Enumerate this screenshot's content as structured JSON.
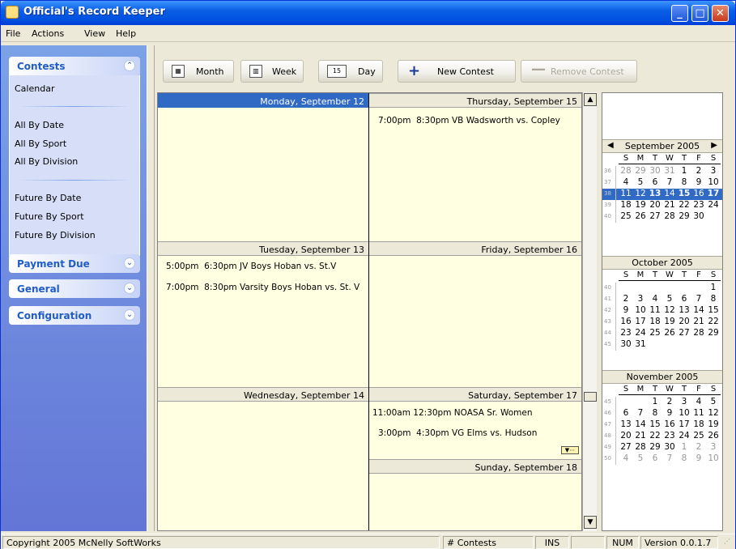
{
  "window": {
    "title": "Official's Record Keeper",
    "btn_min": "_",
    "btn_max": "□",
    "btn_close": "✕"
  },
  "menu": [
    "File",
    "Actions",
    "View",
    "Help"
  ],
  "sidebar": {
    "contests": {
      "title": "Contests",
      "items": [
        "Calendar",
        "All By Date",
        "All By Sport",
        "All By Division",
        "Future By Date",
        "Future By Sport",
        "Future By Division"
      ]
    },
    "collapsed": [
      "Payment Due",
      "General",
      "Configuration"
    ],
    "expand_glyph": "⌄",
    "collapse_glyph": "⌃"
  },
  "toolbar": {
    "month": "Month",
    "week": "Week",
    "day": "Day",
    "new_contest": "New Contest",
    "remove_contest": "Remove Contest",
    "plus": "+",
    "minus": "—"
  },
  "week_view": {
    "days": [
      {
        "label": "Monday, September 12",
        "selected": true,
        "appointments": []
      },
      {
        "label": "Tuesday, September 13",
        "selected": false,
        "appointments": [
          {
            "start": "5:00pm",
            "end": "6:30pm",
            "title": "JV Boys Hoban vs. St.V"
          },
          {
            "start": "7:00pm",
            "end": "8:30pm",
            "title": "Varsity Boys Hoban vs. St. V"
          }
        ]
      },
      {
        "label": "Wednesday, September 14",
        "selected": false,
        "appointments": []
      },
      {
        "label": "Thursday, September 15",
        "selected": false,
        "appointments": [
          {
            "start": "7:00pm",
            "end": "8:30pm",
            "title": "VB Wadsworth vs. Copley"
          }
        ]
      },
      {
        "label": "Friday, September 16",
        "selected": false,
        "appointments": []
      },
      {
        "label": "Saturday, September 17",
        "selected": false,
        "appointments": [
          {
            "start": "11:00am",
            "end": "12:30pm",
            "title": "NOASA Sr. Women"
          },
          {
            "start": "3:00pm",
            "end": "4:30pm",
            "title": "VG Elms vs. Hudson"
          }
        ]
      },
      {
        "label": "Sunday, September 18",
        "selected": false,
        "appointments": []
      }
    ]
  },
  "minicals": [
    {
      "title": "September 2005",
      "nav": true,
      "dow": [
        "S",
        "M",
        "T",
        "W",
        "T",
        "F",
        "S"
      ],
      "weeks": [
        {
          "wk": "36",
          "days": [
            "28",
            "29",
            "30",
            "31",
            "1",
            "2",
            "3"
          ],
          "other": [
            0,
            1,
            2,
            3
          ]
        },
        {
          "wk": "37",
          "days": [
            "4",
            "5",
            "6",
            "7",
            "8",
            "9",
            "10"
          ],
          "other": []
        },
        {
          "wk": "38",
          "days": [
            "11",
            "12",
            "13",
            "14",
            "15",
            "16",
            "17"
          ],
          "other": [],
          "selected": true,
          "bold": [
            2,
            4,
            6
          ]
        },
        {
          "wk": "39",
          "days": [
            "18",
            "19",
            "20",
            "21",
            "22",
            "23",
            "24"
          ],
          "other": []
        },
        {
          "wk": "40",
          "days": [
            "25",
            "26",
            "27",
            "28",
            "29",
            "30",
            ""
          ],
          "other": []
        }
      ]
    },
    {
      "title": "October 2005",
      "nav": false,
      "dow": [
        "S",
        "M",
        "T",
        "W",
        "T",
        "F",
        "S"
      ],
      "weeks": [
        {
          "wk": "40",
          "days": [
            "",
            "",
            "",
            "",
            "",
            "",
            "1"
          ],
          "other": []
        },
        {
          "wk": "41",
          "days": [
            "2",
            "3",
            "4",
            "5",
            "6",
            "7",
            "8"
          ],
          "other": []
        },
        {
          "wk": "42",
          "days": [
            "9",
            "10",
            "11",
            "12",
            "13",
            "14",
            "15"
          ],
          "other": []
        },
        {
          "wk": "43",
          "days": [
            "16",
            "17",
            "18",
            "19",
            "20",
            "21",
            "22"
          ],
          "other": []
        },
        {
          "wk": "44",
          "days": [
            "23",
            "24",
            "25",
            "26",
            "27",
            "28",
            "29"
          ],
          "other": []
        },
        {
          "wk": "45",
          "days": [
            "30",
            "31",
            "",
            "",
            "",
            "",
            ""
          ],
          "other": []
        }
      ]
    },
    {
      "title": "November 2005",
      "nav": false,
      "dow": [
        "S",
        "M",
        "T",
        "W",
        "T",
        "F",
        "S"
      ],
      "weeks": [
        {
          "wk": "45",
          "days": [
            "",
            "",
            "1",
            "2",
            "3",
            "4",
            "5"
          ],
          "other": []
        },
        {
          "wk": "46",
          "days": [
            "6",
            "7",
            "8",
            "9",
            "10",
            "11",
            "12"
          ],
          "other": []
        },
        {
          "wk": "47",
          "days": [
            "13",
            "14",
            "15",
            "16",
            "17",
            "18",
            "19"
          ],
          "other": []
        },
        {
          "wk": "48",
          "days": [
            "20",
            "21",
            "22",
            "23",
            "24",
            "25",
            "26"
          ],
          "other": []
        },
        {
          "wk": "49",
          "days": [
            "27",
            "28",
            "29",
            "30",
            "1",
            "2",
            "3"
          ],
          "other": [
            4,
            5,
            6
          ]
        },
        {
          "wk": "50",
          "days": [
            "4",
            "5",
            "6",
            "7",
            "8",
            "9",
            "10"
          ],
          "other": [
            0,
            1,
            2,
            3,
            4,
            5,
            6
          ]
        }
      ]
    }
  ],
  "status": {
    "copyright": "Copyright 2005 McNelly SoftWorks",
    "contests": "# Contests",
    "ins": "INS",
    "num": "NUM",
    "version": "Version 0.0.1.7"
  }
}
